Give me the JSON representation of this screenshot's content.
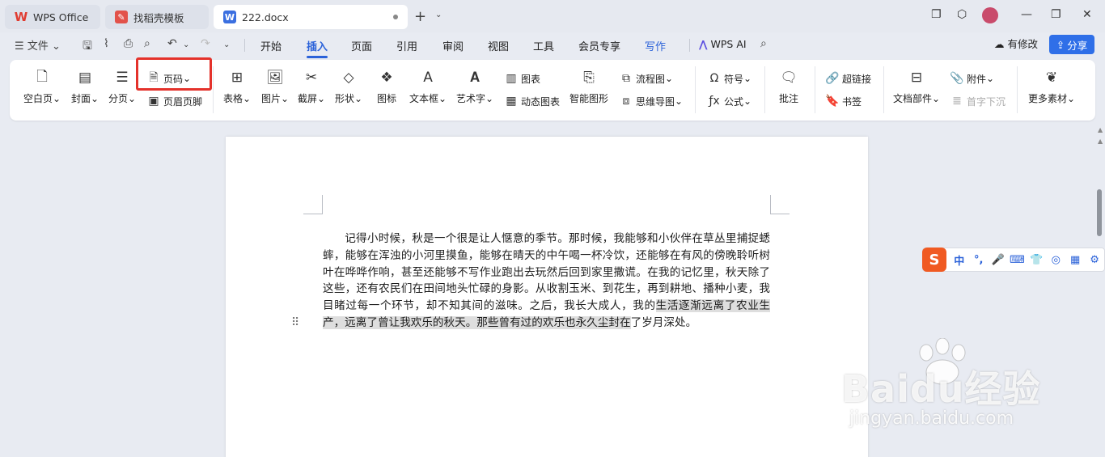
{
  "tabs": [
    {
      "label": "WPS Office",
      "icon": "wps-logo-icon"
    },
    {
      "label": "找稻壳模板",
      "icon": "daoke-icon"
    },
    {
      "label": "222.docx",
      "icon": "word-doc-icon"
    }
  ],
  "menu": {
    "file": "文件",
    "items": [
      "开始",
      "插入",
      "页面",
      "引用",
      "审阅",
      "视图",
      "工具",
      "会员专享",
      "写作"
    ],
    "active": "插入",
    "wps_ai": "WPS AI",
    "modified": "有修改",
    "share": "分享"
  },
  "ribbon": {
    "blank_page": "空白页",
    "cover": "封面",
    "page_break": "分页",
    "page_number": "页码",
    "header_footer": "页眉页脚",
    "table": "表格",
    "picture": "图片",
    "screenshot": "截屏",
    "shape": "形状",
    "icon": "图标",
    "textbox": "文本框",
    "wordart": "艺术字",
    "chart": "图表",
    "dynamic_chart": "动态图表",
    "smart_shape": "智能图形",
    "flowchart": "流程图",
    "mindmap": "思维导图",
    "symbol": "符号",
    "formula": "公式",
    "comment": "批注",
    "hyperlink": "超链接",
    "bookmark": "书签",
    "doc_parts": "文档部件",
    "attachment": "附件",
    "drop_cap": "首字下沉",
    "more": "更多素材"
  },
  "document": {
    "paragraph_normal": "记得小时候，秋是一个很是让人惬意的季节。那时候，我能够和小伙伴在草丛里捕捉蟋蟀，能够在浑浊的小河里摸鱼，能够在晴天的中午喝一杯冷饮，还能够在有风的傍晚聆听树叶在哗哗作响，甚至还能够不写作业跑出去玩然后回到家里撒谎。在我的记忆里，秋天除了这些，还有农民们在田间地头忙碌的身影。从收割玉米、到花生，再到耕地、播种小麦，我目睹过每一个环节，却不知其间的滋味。之后，我长大成人，我的",
    "paragraph_selected": "生活逐渐远离了农业生产，远离了曾让我欢乐的秋天。那些曾有过的欢乐也永久尘封在",
    "paragraph_tail": "了岁月深处。"
  },
  "ime": {
    "label": "中"
  },
  "watermark": {
    "line1": "Baidu经验",
    "line2": "jingyan.baidu.com"
  },
  "colors": {
    "accent": "#2b62d9",
    "highlight": "#e4322b",
    "share_bg": "#2f6fe8"
  }
}
